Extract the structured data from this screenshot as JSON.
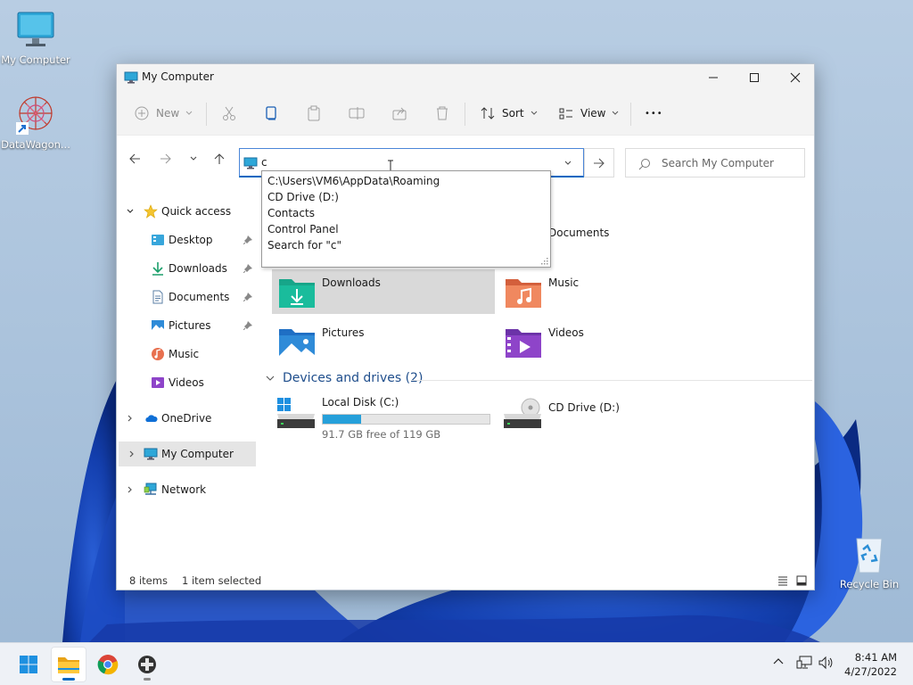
{
  "desktop": {
    "icons": [
      {
        "label": "My Computer"
      },
      {
        "label": "DataWagon..."
      },
      {
        "label": "Recycle Bin"
      }
    ]
  },
  "window": {
    "title": "My Computer",
    "toolbar": {
      "new_label": "New",
      "sort_label": "Sort",
      "view_label": "View",
      "more_label": "•••"
    },
    "address": {
      "value": "c",
      "autocomplete": [
        "C:\\Users\\VM6\\AppData\\Roaming",
        "CD Drive (D:)",
        "Contacts",
        "Control Panel",
        "Search for \"c\""
      ]
    },
    "search": {
      "placeholder": "Search My Computer"
    },
    "sidebar": {
      "quick_access": "Quick access",
      "items": [
        {
          "label": "Desktop"
        },
        {
          "label": "Downloads"
        },
        {
          "label": "Documents"
        },
        {
          "label": "Pictures"
        },
        {
          "label": "Music"
        },
        {
          "label": "Videos"
        }
      ],
      "onedrive": "OneDrive",
      "my_computer": "My Computer",
      "network": "Network"
    },
    "folders": [
      {
        "name": "Documents"
      },
      {
        "name": "Downloads"
      },
      {
        "name": "Music"
      },
      {
        "name": "Pictures"
      },
      {
        "name": "Videos"
      }
    ],
    "devices_header": "Devices and drives (2)",
    "drives": [
      {
        "name": "Local Disk (C:)",
        "free_text": "91.7 GB free of 119 GB",
        "used_fraction": 0.23
      },
      {
        "name": "CD Drive (D:)"
      }
    ],
    "status": {
      "items": "8 items",
      "selected": "1 item selected"
    }
  },
  "taskbar": {
    "time": "8:41 AM",
    "date": "4/27/2022"
  },
  "colors": {
    "accent": "#0067c0",
    "drive_bar": "#26a0da",
    "selection": "#d9d9d9"
  }
}
